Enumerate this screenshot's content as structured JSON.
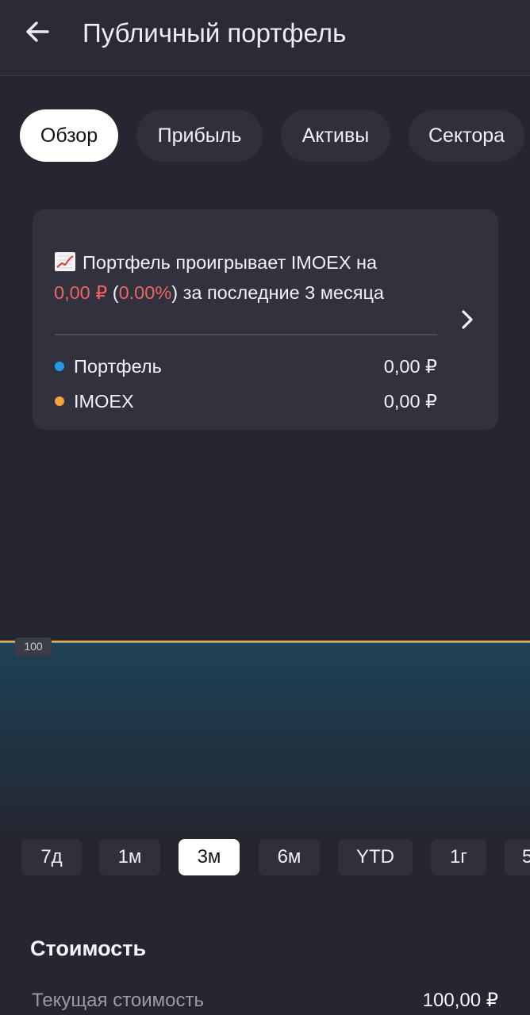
{
  "header": {
    "title": "Публичный портфель"
  },
  "tabs": [
    {
      "label": "Обзор",
      "active": true
    },
    {
      "label": "Прибыль",
      "active": false
    },
    {
      "label": "Активы",
      "active": false
    },
    {
      "label": "Сектора",
      "active": false
    }
  ],
  "card": {
    "icon": "chart-increasing-icon",
    "headline_prefix": "Портфель проигрывает IMOEX на",
    "diff_amount": "0,00 ₽",
    "diff_open": " (",
    "diff_percent": "0.00%",
    "diff_close": ")",
    "headline_suffix": " за последние 3 месяца",
    "legend": [
      {
        "name": "Портфель",
        "value": "0,00 ₽",
        "color": "#1e9ee8"
      },
      {
        "name": "IMOEX",
        "value": "0,00 ₽",
        "color": "#f5a33b"
      }
    ]
  },
  "chart": {
    "axis_label": "100",
    "colors": {
      "portfolio": "#1e9ee8",
      "benchmark": "#f5a33b"
    }
  },
  "periods": [
    {
      "label": "7д",
      "active": false
    },
    {
      "label": "1м",
      "active": false
    },
    {
      "label": "3м",
      "active": true
    },
    {
      "label": "6м",
      "active": false
    },
    {
      "label": "YTD",
      "active": false
    },
    {
      "label": "1г",
      "active": false
    },
    {
      "label": "5",
      "active": false
    }
  ],
  "value_section": {
    "title": "Стоимость",
    "current_label": "Текущая стоимость",
    "current_value": "100,00 ₽"
  },
  "colors": {
    "background": "#252630",
    "card": "#31323d",
    "negative": "#f0655f"
  }
}
